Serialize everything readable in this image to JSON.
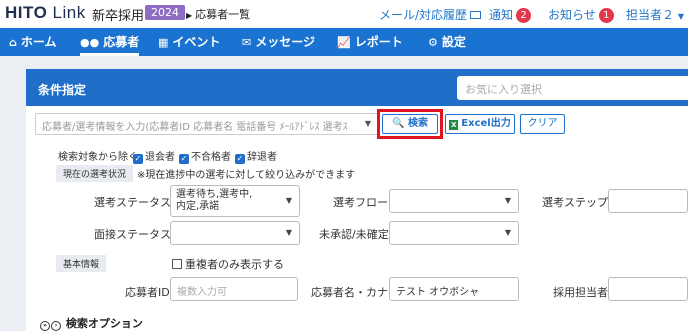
{
  "app": {
    "logo_hito": "HITO",
    "logo_link": "Link",
    "subtitle": "新卒採用",
    "year": "2024",
    "breadcrumb": "応募者一覧"
  },
  "top_right": {
    "mail_history": "メール/対応履歴",
    "notifications": "通知",
    "notifications_count": "2",
    "news": "お知らせ",
    "news_count": "1",
    "user": "担当者２"
  },
  "nav": {
    "items": [
      {
        "label": "ホーム",
        "icon": "home-icon"
      },
      {
        "label": "応募者",
        "icon": "users-icon",
        "active": true
      },
      {
        "label": "イベント",
        "icon": "calendar-icon"
      },
      {
        "label": "メッセージ",
        "icon": "envelope-icon"
      },
      {
        "label": "レポート",
        "icon": "chart-icon"
      },
      {
        "label": "設定",
        "icon": "gear-icon"
      }
    ]
  },
  "panel": {
    "title": "条件指定",
    "favorite_placeholder": "お気に入り選択",
    "search_placeholder": "応募者/選考情報を入力(応募者ID 応募者名 電話番号 ﾒｰﾙｱﾄﾞﾚｽ 選考ｽ",
    "search_button": "検索",
    "excel_button": "Excel出力",
    "clear_button": "クリア"
  },
  "exclude": {
    "label": "検索対象から除く",
    "options": [
      "退会者",
      "不合格者",
      "辞退者"
    ]
  },
  "current": {
    "label": "現在の選考状況",
    "note": "※現在進捗中の選考に対して絞り込みができます"
  },
  "fields": {
    "selection_status_label": "選考ステータス",
    "selection_status_value_1": "選考待ち,選考中,",
    "selection_status_value_2": "内定,承諾",
    "selection_flow_label": "選考フロー",
    "selection_step_label": "選考ステップ",
    "interview_status_label": "面接ステータス",
    "approval_label": "未承認/未確定",
    "basic_info_label": "基本情報",
    "duplicate_only": "重複者のみ表示する",
    "applicant_id_label": "応募者ID",
    "applicant_id_placeholder": "複数入力可",
    "applicant_name_label": "応募者名・カナ",
    "applicant_name_value": "テスト オウボシャ",
    "recruiter_label": "採用担当者"
  },
  "search_options": {
    "label": "検索オプション"
  },
  "colors": {
    "nav_blue": "#1a73d0",
    "panel_header": "#1f6fc8",
    "badge_red": "#e5374b",
    "year_purple": "#8e6cc4",
    "highlight_red": "#e0141e"
  }
}
